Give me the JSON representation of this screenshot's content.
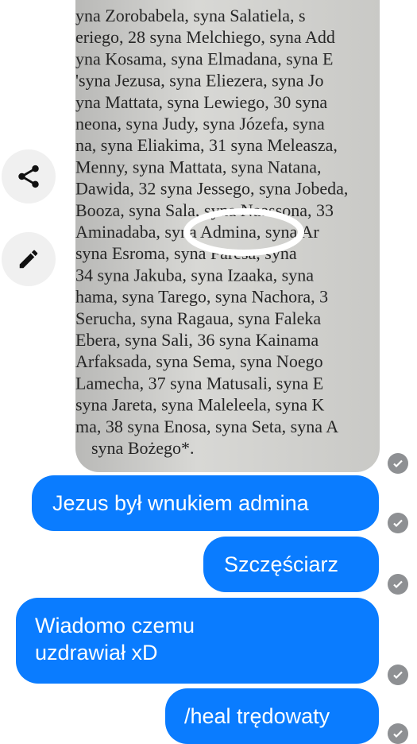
{
  "photo": {
    "lines": [
      "yna Zorobabela, syna Salatiela, s",
      "eriego, 28 syna Melchiego, syna Add",
      "yna Kosama, syna Elmadana, syna E",
      "'syna Jezusa, syna Eliezera, syna Jo",
      "yna Mattata, syna Lewiego, 30 syna",
      "neona, syna Judy, syna Józefa, syna",
      "na, syna Eliakima, 31 syna Meleasza,",
      "Menny, syna Mattata, syna Natana,",
      "Dawida, 32 syna Jessego, syna Jobeda,",
      "Booza, syna Sala, syna Naassona, 33",
      "Aminadaba, syna Admina, syna Ar",
      "syna Esroma, syna Faresa, syna",
      "34 syna Jakuba, syna Izaaka, syna",
      "hama, syna Tarego, syna Nachora, 3",
      "Serucha, syna Ragaua, syna Faleka",
      "Ebera, syna Sali, 36 syna Kainama",
      "Arfaksada, syna Sema, syna Noego",
      "Lamecha, 37 syna Matusali, syna E",
      "syna Jareta, syna Maleleela, syna K",
      "ma, 38 syna Enosa, syna Seta, syna A",
      "syna Bożego*."
    ]
  },
  "actions": {
    "share_icon": "share-icon",
    "edit_icon": "pencil-icon"
  },
  "messages": [
    {
      "text": "Jezus był wnukiem admina"
    },
    {
      "text": "Szczęściarz"
    },
    {
      "text": "Wiadomo czemu uzdrawiał xD"
    },
    {
      "text": "/heal trędowaty"
    }
  ],
  "colors": {
    "bubble": "#0a7cff",
    "seen_badge": "#8e9093",
    "highlight_circle": "#ffffff"
  }
}
